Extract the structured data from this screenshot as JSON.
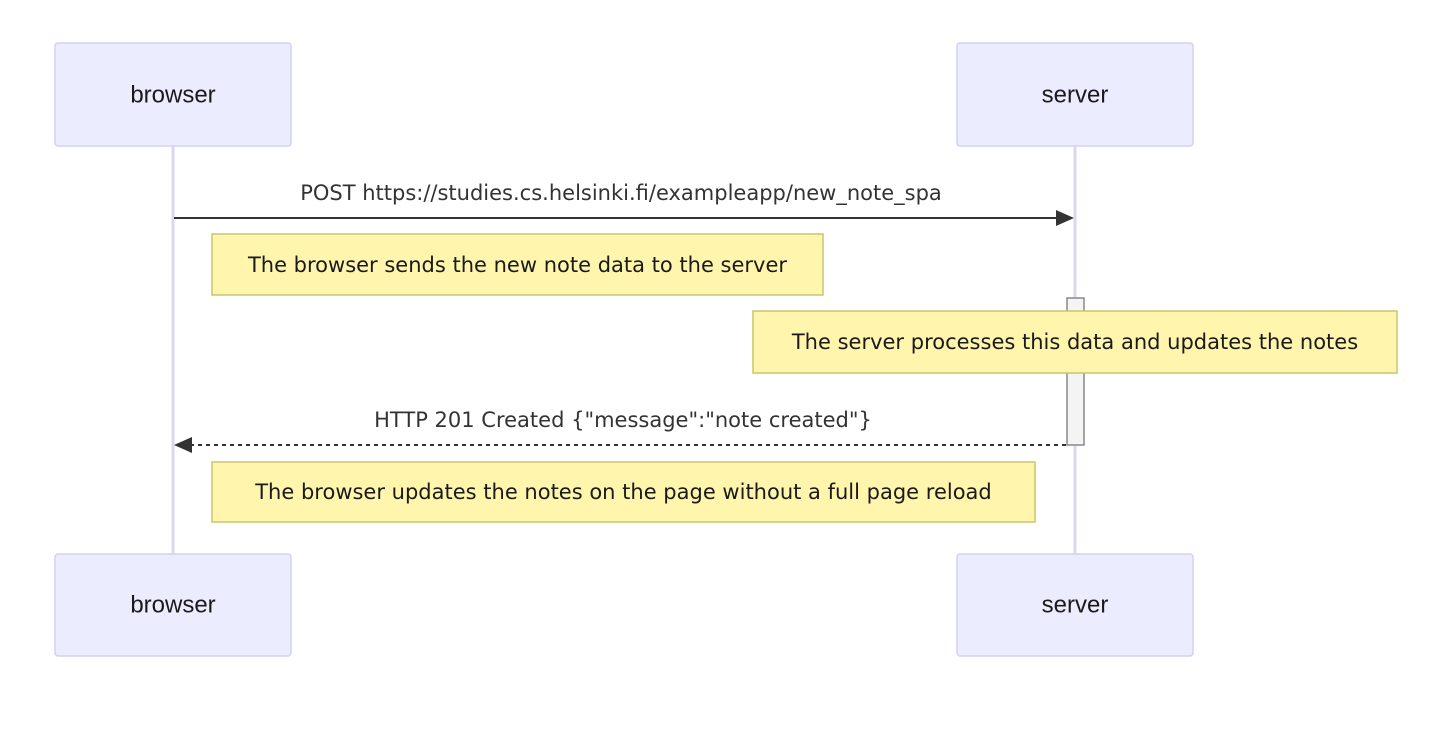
{
  "participants": {
    "browser": "browser",
    "server": "server"
  },
  "messages": {
    "post": "POST https://studies.cs.helsinki.fi/exampleapp/new_note_spa",
    "response": "HTTP 201 Created {\"message\":\"note created\"}"
  },
  "notes": {
    "browser_sends": "The browser sends the new note data to the server",
    "server_processes": "The server processes this data and updates the notes",
    "browser_updates": "The browser updates the notes on the page without a full page reload"
  },
  "colors": {
    "actor_fill": "#ececff",
    "note_fill": "#fff5ad",
    "lifeline": "#ddd6f0"
  }
}
